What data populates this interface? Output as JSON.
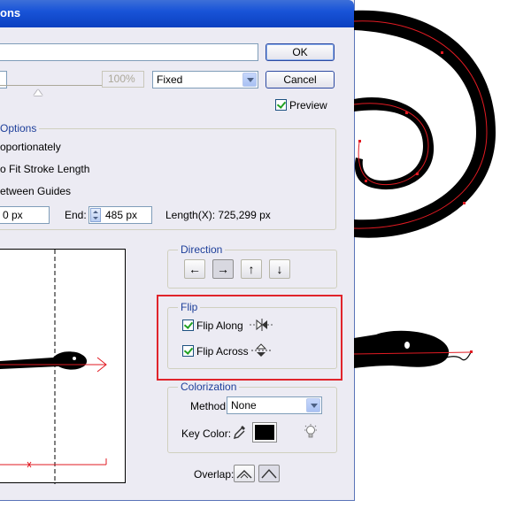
{
  "dialog": {
    "title": "ons",
    "ok_label": "OK",
    "cancel_label": "Cancel",
    "name_value": "",
    "zoom_disabled": "100%",
    "fit_select": "Fixed",
    "preview_label": "Preview",
    "preview_checked": true
  },
  "options": {
    "title": "Options",
    "proportionately": "oportionately",
    "fit_stroke": "o Fit Stroke Length",
    "between_guides": "etween Guides",
    "start_value": "0 px",
    "end_label": "End:",
    "end_value": "485 px",
    "length_label": "Length(X): 725,299 px"
  },
  "direction": {
    "title": "Direction",
    "buttons": [
      "←",
      "→",
      "↑",
      "↓"
    ],
    "active_index": 1
  },
  "flip": {
    "title": "Flip",
    "along_label": "Flip Along",
    "across_label": "Flip Across",
    "along_checked": true,
    "across_checked": true
  },
  "colorization": {
    "title": "Colorization",
    "method_label": "Method:",
    "method_value": "None",
    "key_color_label": "Key Color:",
    "key_color": "#000000"
  },
  "overlap": {
    "label": "Overlap:"
  },
  "colors": {
    "accent_red": "#e0242b",
    "path_red": "#e11a22",
    "title_blue": "#1954d8"
  }
}
